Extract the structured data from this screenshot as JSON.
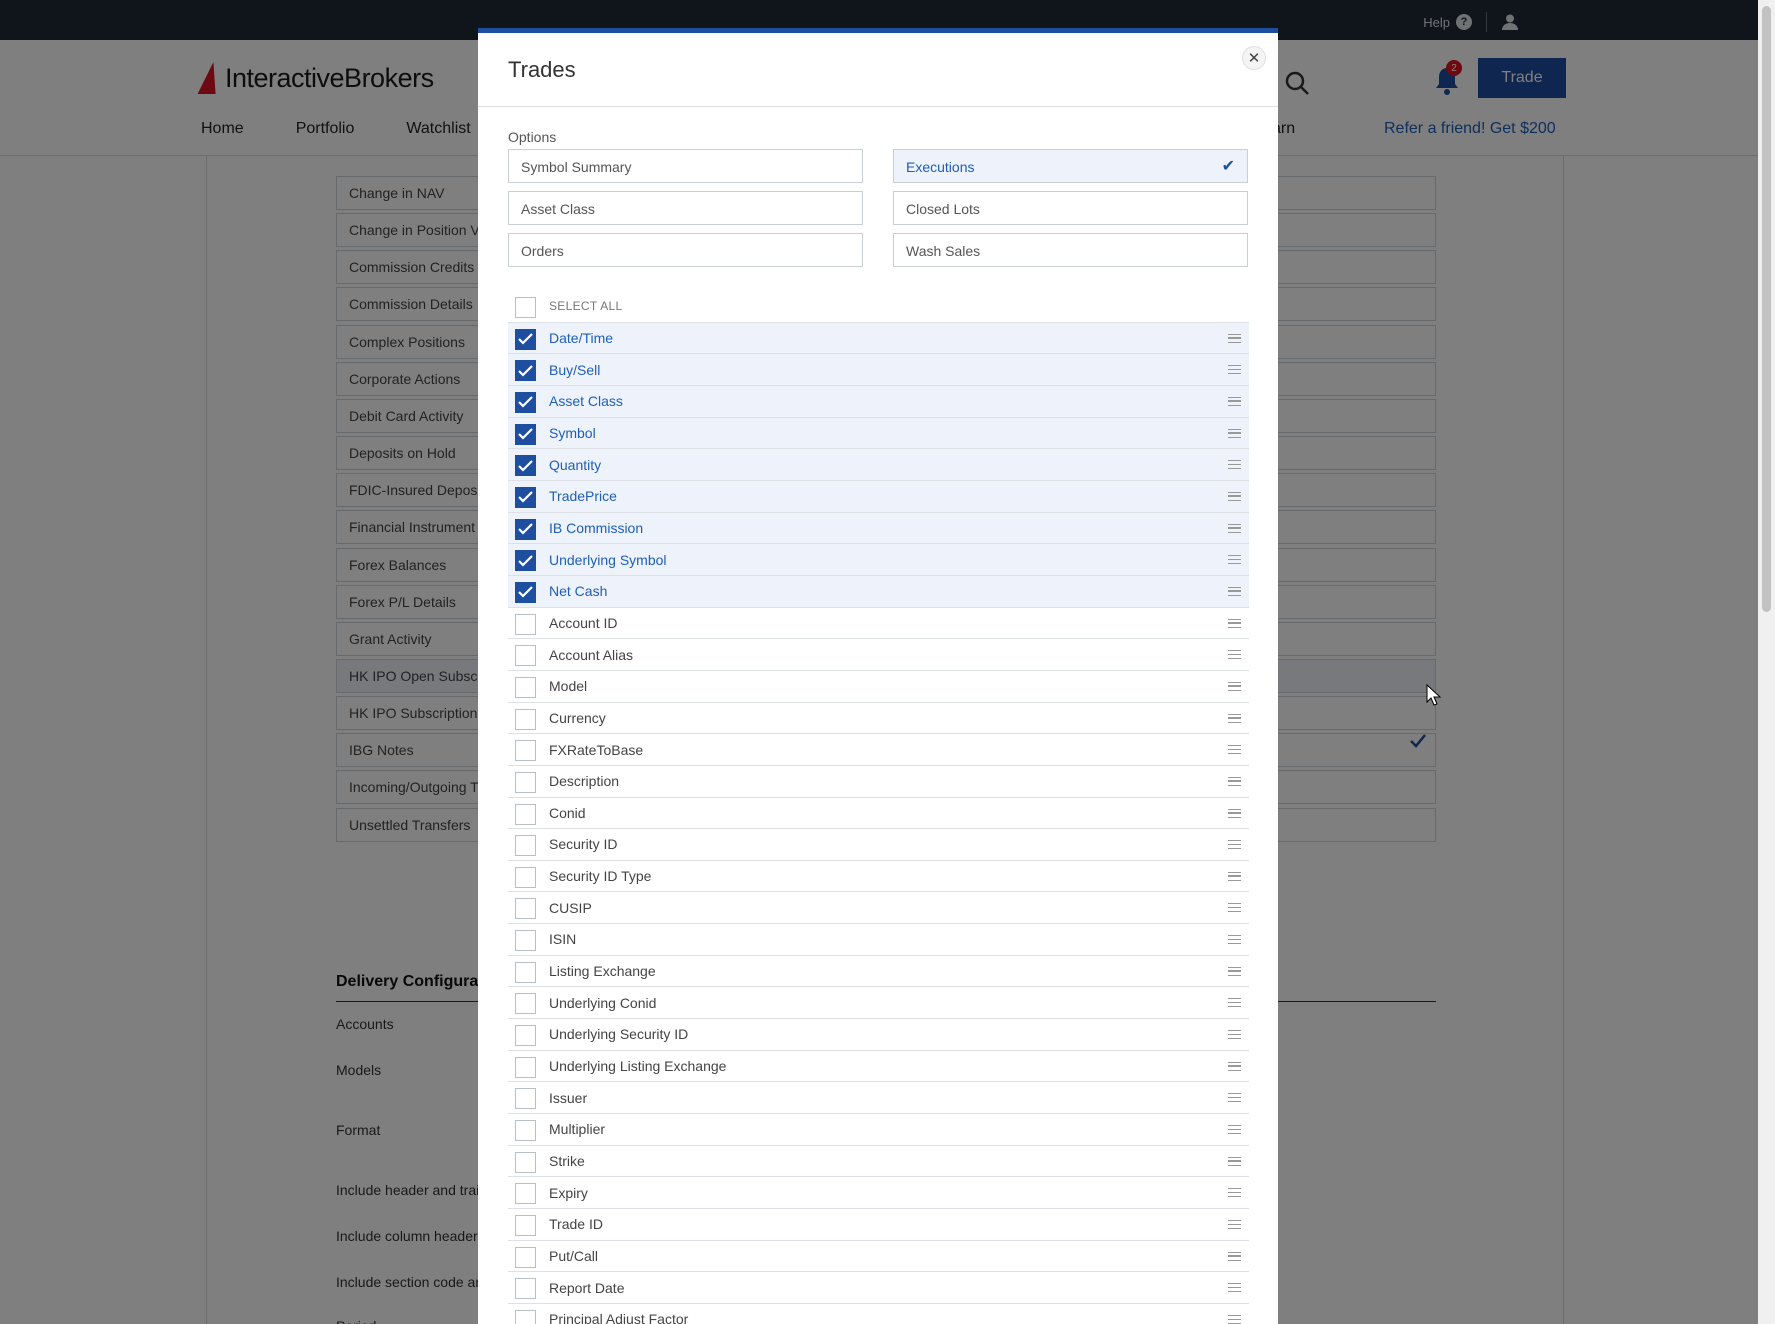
{
  "topbar": {
    "help": "Help",
    "help_icon": "?"
  },
  "header": {
    "brand": "InteractiveBrokers",
    "nav": [
      "Home",
      "Portfolio",
      "Watchlist"
    ],
    "nav_partial": "arn",
    "refer": "Refer a friend! Get $200",
    "trade": "Trade",
    "notifications": "2"
  },
  "background": {
    "sections": [
      "Change in NAV",
      "Change in Position V",
      "Commission Credits",
      "Commission Details",
      "Complex Positions",
      "Corporate Actions",
      "Debit Card Activity",
      "Deposits on Hold",
      "FDIC-Insured Deposi",
      "Financial Instrument I",
      "Forex Balances",
      "Forex P/L Details",
      "Grant Activity",
      "HK IPO Open Subscri",
      "HK IPO Subscription ",
      "IBG Notes",
      "Incoming/Outgoing T",
      "Unsettled Transfers"
    ],
    "delivery_title": "Delivery Configurati",
    "delivery_labels": [
      "Accounts",
      "Models",
      "Format",
      "Include header and trai",
      "Include column header",
      "Include section code ar",
      "Period"
    ]
  },
  "modal": {
    "title": "Trades",
    "options_label": "Options",
    "options": [
      {
        "label": "Symbol Summary",
        "active": false
      },
      {
        "label": "Executions",
        "active": true
      },
      {
        "label": "Asset Class",
        "active": false
      },
      {
        "label": "Closed Lots",
        "active": false
      },
      {
        "label": "Orders",
        "active": false
      },
      {
        "label": "Wash Sales",
        "active": false
      }
    ],
    "select_all": "SELECT ALL",
    "fields": [
      {
        "label": "Date/Time",
        "checked": true
      },
      {
        "label": "Buy/Sell",
        "checked": true
      },
      {
        "label": "Asset Class",
        "checked": true
      },
      {
        "label": "Symbol",
        "checked": true
      },
      {
        "label": "Quantity",
        "checked": true
      },
      {
        "label": "TradePrice",
        "checked": true
      },
      {
        "label": "IB Commission",
        "checked": true
      },
      {
        "label": "Underlying Symbol",
        "checked": true
      },
      {
        "label": "Net Cash",
        "checked": true
      },
      {
        "label": "Account ID",
        "checked": false
      },
      {
        "label": "Account Alias",
        "checked": false
      },
      {
        "label": "Model",
        "checked": false
      },
      {
        "label": "Currency",
        "checked": false
      },
      {
        "label": "FXRateToBase",
        "checked": false
      },
      {
        "label": "Description",
        "checked": false
      },
      {
        "label": "Conid",
        "checked": false
      },
      {
        "label": "Security ID",
        "checked": false
      },
      {
        "label": "Security ID Type",
        "checked": false
      },
      {
        "label": "CUSIP",
        "checked": false
      },
      {
        "label": "ISIN",
        "checked": false
      },
      {
        "label": "Listing Exchange",
        "checked": false
      },
      {
        "label": "Underlying Conid",
        "checked": false
      },
      {
        "label": "Underlying Security ID",
        "checked": false
      },
      {
        "label": "Underlying Listing Exchange",
        "checked": false
      },
      {
        "label": "Issuer",
        "checked": false
      },
      {
        "label": "Multiplier",
        "checked": false
      },
      {
        "label": "Strike",
        "checked": false
      },
      {
        "label": "Expiry",
        "checked": false
      },
      {
        "label": "Trade ID",
        "checked": false
      },
      {
        "label": "Put/Call",
        "checked": false
      },
      {
        "label": "Report Date",
        "checked": false
      },
      {
        "label": "Principal Adjust Factor",
        "checked": false
      }
    ]
  },
  "colors": {
    "accent": "#1e4ea0",
    "link": "#1e5eb8",
    "brand_red": "#d81222",
    "topbar": "#1f2a36"
  }
}
